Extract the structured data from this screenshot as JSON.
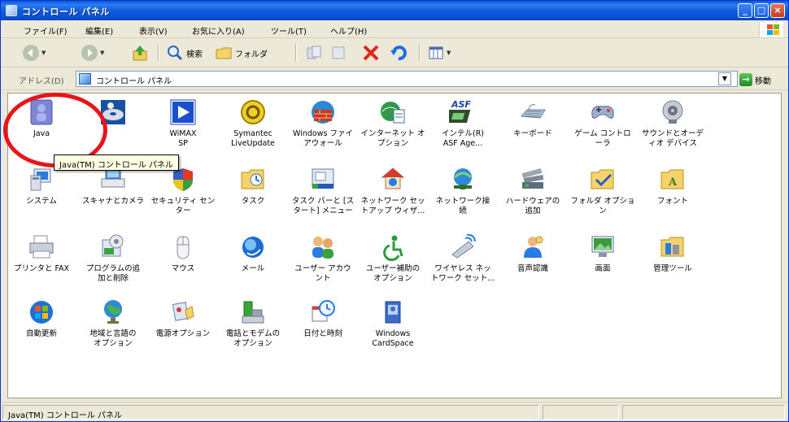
{
  "window": {
    "title": "コントロール パネル",
    "min": "_",
    "max": "□",
    "close": "×"
  },
  "menu": [
    "ファイル(F)",
    "編集(E)",
    "表示(V)",
    "お気に入り(A)",
    "ツール(T)",
    "ヘルプ(H)"
  ],
  "toolbar": {
    "back_label": "",
    "search_label": "検索",
    "folders_label": "フォルダ"
  },
  "address": {
    "label": "アドレス(D)",
    "value": "コントロール パネル",
    "go_label": "移動"
  },
  "items": [
    {
      "label": "Java",
      "icon": "java-icon"
    },
    {
      "label": "",
      "icon": "disc-icon"
    },
    {
      "label": "WiMAX\nSP",
      "icon": "play-icon"
    },
    {
      "label": "Symantec\nLiveUpdate",
      "icon": "liveupdate-icon"
    },
    {
      "label": "Windows ファイ\nアウォール",
      "icon": "firewall-icon"
    },
    {
      "label": "インターネット オ\nプション",
      "icon": "internet-options-icon"
    },
    {
      "label": "インテル(R)\nASF Age...",
      "icon": "asf-icon"
    },
    {
      "label": "キーボード",
      "icon": "keyboard-icon"
    },
    {
      "label": "ゲーム コントロ\nーラ",
      "icon": "game-controller-icon"
    },
    {
      "label": "サウンドとオーデ\nィオ デバイス",
      "icon": "speaker-icon"
    },
    {
      "label": "システム",
      "icon": "system-icon"
    },
    {
      "label": "スキャナとカメラ",
      "icon": "scanner-icon"
    },
    {
      "label": "セキュリティ セン\nター",
      "icon": "security-center-icon"
    },
    {
      "label": "タスク",
      "icon": "tasks-icon"
    },
    {
      "label": "タスク バーと [ス\nタート] メニュー",
      "icon": "taskbar-icon"
    },
    {
      "label": "ネットワーク セッ\nトアップ ウィザ...",
      "icon": "network-setup-icon"
    },
    {
      "label": "ネットワーク接\n続",
      "icon": "network-connections-icon"
    },
    {
      "label": "ハードウェアの\n追加",
      "icon": "add-hardware-icon"
    },
    {
      "label": "フォルダ オプショ\nン",
      "icon": "folder-options-icon"
    },
    {
      "label": "フォント",
      "icon": "fonts-icon"
    },
    {
      "label": "プリンタと FAX",
      "icon": "printer-icon"
    },
    {
      "label": "プログラムの追\n加と削除",
      "icon": "add-remove-programs-icon"
    },
    {
      "label": "マウス",
      "icon": "mouse-icon"
    },
    {
      "label": "メール",
      "icon": "mail-icon"
    },
    {
      "label": "ユーザー アカウ\nント",
      "icon": "user-accounts-icon"
    },
    {
      "label": "ユーザー補助の\nオプション",
      "icon": "accessibility-icon"
    },
    {
      "label": "ワイヤレス ネッ\nトワーク セット...",
      "icon": "wireless-network-icon"
    },
    {
      "label": "音声認識",
      "icon": "speech-icon"
    },
    {
      "label": "画面",
      "icon": "display-icon"
    },
    {
      "label": "管理ツール",
      "icon": "admin-tools-icon"
    },
    {
      "label": "自動更新",
      "icon": "automatic-updates-icon"
    },
    {
      "label": "地域と言語の\nオプション",
      "icon": "regional-icon"
    },
    {
      "label": "電源オプション",
      "icon": "power-options-icon"
    },
    {
      "label": "電話とモデムの\nオプション",
      "icon": "phone-modem-icon"
    },
    {
      "label": "日付と時刻",
      "icon": "date-time-icon"
    },
    {
      "label": "Windows\nCardSpace",
      "icon": "cardspace-icon"
    }
  ],
  "tooltip": "Java(TM) コントロール パネル",
  "status": {
    "text": "Java(TM) コントロール パネル"
  },
  "colors": {
    "titlebar": "#0b5ae0",
    "highlight": "#e8141a",
    "tooltip_bg": "#ffffe1"
  }
}
